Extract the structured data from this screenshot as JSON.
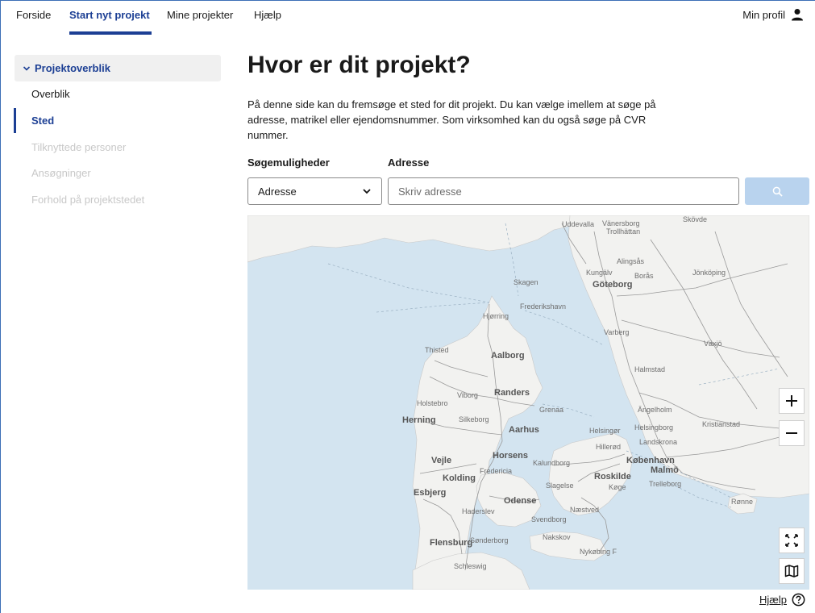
{
  "nav": {
    "items": [
      "Forside",
      "Start nyt projekt",
      "Mine projekter",
      "Hjælp"
    ],
    "active": "Start nyt projekt",
    "profile_label": "Min profil"
  },
  "sidebar": {
    "header": "Projektoverblik",
    "items": [
      {
        "label": "Overblik",
        "state": "normal"
      },
      {
        "label": "Sted",
        "state": "current"
      },
      {
        "label": "Tilknyttede personer",
        "state": "disabled"
      },
      {
        "label": "Ansøgninger",
        "state": "disabled"
      },
      {
        "label": "Forhold på projektstedet",
        "state": "disabled"
      }
    ]
  },
  "main": {
    "title": "Hvor er dit projekt?",
    "intro": "På denne side kan du fremsøge et sted for dit projekt. Du kan vælge imellem at søge på adresse, matrikel eller ejendomsnummer. Som virksomhed kan du også søge på CVR nummer.",
    "search_options_label": "Søgemuligheder",
    "search_option_selected": "Adresse",
    "address_label": "Adresse",
    "address_placeholder": "Skriv adresse",
    "address_value": ""
  },
  "map": {
    "cities": [
      {
        "name": "Uddevalla",
        "big": false
      },
      {
        "name": "Vänersborg",
        "big": false
      },
      {
        "name": "Trollhättan",
        "big": false
      },
      {
        "name": "Skövde",
        "big": false
      },
      {
        "name": "Kungälv",
        "big": false
      },
      {
        "name": "Alingsås",
        "big": false
      },
      {
        "name": "Borås",
        "big": false
      },
      {
        "name": "Jönköping",
        "big": false
      },
      {
        "name": "Göteborg",
        "big": true
      },
      {
        "name": "Skagen",
        "big": false
      },
      {
        "name": "Frederikshavn",
        "big": false
      },
      {
        "name": "Hjørring",
        "big": false
      },
      {
        "name": "Varberg",
        "big": false
      },
      {
        "name": "Växjö",
        "big": false
      },
      {
        "name": "Thisted",
        "big": false
      },
      {
        "name": "Aalborg",
        "big": true
      },
      {
        "name": "Halmstad",
        "big": false
      },
      {
        "name": "Randers",
        "big": true
      },
      {
        "name": "Viborg",
        "big": false
      },
      {
        "name": "Holstebro",
        "big": false
      },
      {
        "name": "Grenaa",
        "big": false
      },
      {
        "name": "Ängelholm",
        "big": false
      },
      {
        "name": "Herning",
        "big": true
      },
      {
        "name": "Silkeborg",
        "big": false
      },
      {
        "name": "Aarhus",
        "big": true
      },
      {
        "name": "Helsingør",
        "big": false
      },
      {
        "name": "Helsingborg",
        "big": false
      },
      {
        "name": "Kristianstad",
        "big": false
      },
      {
        "name": "Hillerød",
        "big": false
      },
      {
        "name": "Landskrona",
        "big": false
      },
      {
        "name": "Horsens",
        "big": true
      },
      {
        "name": "Vejle",
        "big": true
      },
      {
        "name": "Kalundborg",
        "big": false
      },
      {
        "name": "København",
        "big": true
      },
      {
        "name": "Malmö",
        "big": true
      },
      {
        "name": "Fredericia",
        "big": false
      },
      {
        "name": "Kolding",
        "big": true
      },
      {
        "name": "Roskilde",
        "big": true
      },
      {
        "name": "Esbjerg",
        "big": true
      },
      {
        "name": "Slagelse",
        "big": false
      },
      {
        "name": "Køge",
        "big": false
      },
      {
        "name": "Trelleborg",
        "big": false
      },
      {
        "name": "Odense",
        "big": true
      },
      {
        "name": "Rønne",
        "big": false
      },
      {
        "name": "Haderslev",
        "big": false
      },
      {
        "name": "Næstved",
        "big": false
      },
      {
        "name": "Svendborg",
        "big": false
      },
      {
        "name": "Nakskov",
        "big": false
      },
      {
        "name": "Flensburg",
        "big": true
      },
      {
        "name": "Sønderborg",
        "big": false
      },
      {
        "name": "Nykøbing F",
        "big": false
      },
      {
        "name": "Schleswig",
        "big": false
      }
    ]
  },
  "help_label": "Hjælp",
  "icons": {
    "profile": "user-icon",
    "chevron": "chevron-down-icon",
    "search": "search-icon",
    "zoom_in": "plus-icon",
    "zoom_out": "minus-icon",
    "fullscreen": "fullscreen-icon",
    "layers": "map-layers-icon",
    "help": "question-circle-icon"
  },
  "colors": {
    "accent": "#1c3f94",
    "search_button": "#b9d3ee",
    "sea": "#d3e4f0",
    "land": "#f2f2f0"
  }
}
